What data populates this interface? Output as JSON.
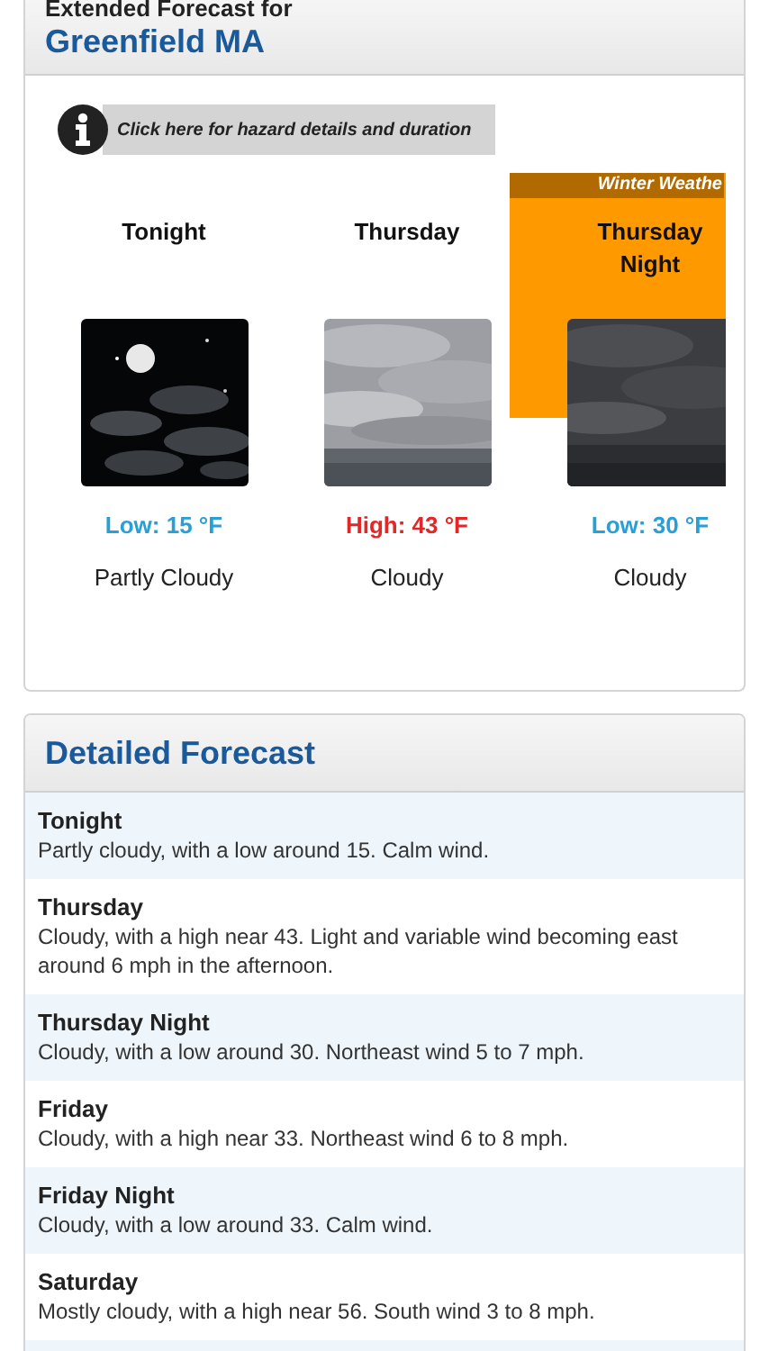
{
  "extended_forecast": {
    "heading": "Extended Forecast for",
    "location": "Greenfield MA",
    "hazard_link": "Click here for hazard details and duration",
    "periods": [
      {
        "name": "Tonight",
        "kind": "night-partly-cloudy",
        "temperature": {
          "kind": "low",
          "text": "Low: 15 °F"
        },
        "summary": "Partly Cloudy"
      },
      {
        "name": "Thursday",
        "kind": "day-cloudy",
        "temperature": {
          "kind": "high",
          "text": "High: 43 °F"
        },
        "summary": "Cloudy"
      },
      {
        "name": "Thursday Night",
        "kind": "night-cloudy",
        "temperature": {
          "kind": "low",
          "text": "Low: 30 °F"
        },
        "summary": "Cloudy",
        "hazard": "Winter Weathe"
      }
    ]
  },
  "detailed_forecast": {
    "title": "Detailed Forecast",
    "rows": [
      {
        "period": "Tonight",
        "text": "Partly cloudy, with a low around 15. Calm wind."
      },
      {
        "period": "Thursday",
        "text": "Cloudy, with a high near 43. Light and variable wind becoming east around 6 mph in the afternoon."
      },
      {
        "period": "Thursday Night",
        "text": "Cloudy, with a low around 30. Northeast wind 5 to 7 mph."
      },
      {
        "period": "Friday",
        "text": "Cloudy, with a high near 33. Northeast wind 6 to 8 mph."
      },
      {
        "period": "Friday Night",
        "text": "Cloudy, with a low around 33. Calm wind."
      },
      {
        "period": "Saturday",
        "text": "Mostly cloudy, with a high near 56. South wind 3 to 8 mph."
      }
    ]
  }
}
